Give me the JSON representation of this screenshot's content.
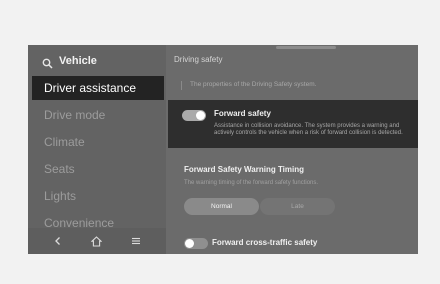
{
  "sidebar": {
    "header": "Vehicle",
    "items": [
      {
        "label": "Driver assistance"
      },
      {
        "label": "Drive mode"
      },
      {
        "label": "Climate"
      },
      {
        "label": "Seats"
      },
      {
        "label": "Lights"
      },
      {
        "label": "Convenience"
      }
    ]
  },
  "content": {
    "title": "Driving safety",
    "description": "The properties of the Driving Safety system.",
    "forward_safety": {
      "title": "Forward safety",
      "description": "Assistance in collision avoidance. The system provides a warning and actively controls the vehicle when a risk of forward collision is detected."
    },
    "warning_timing": {
      "title": "Forward Safety Warning Timing",
      "description": "The warning timing of the forward safety functions.",
      "options": [
        "Normal",
        "Late"
      ],
      "selected": "Normal"
    },
    "cross_traffic": {
      "title": "Forward cross-traffic safety"
    }
  },
  "colors": {
    "screen_bg": "#6b6b6b",
    "sidebar_bg": "#636363",
    "active_item_bg": "#232323",
    "card_bg": "#2e2e2e"
  }
}
